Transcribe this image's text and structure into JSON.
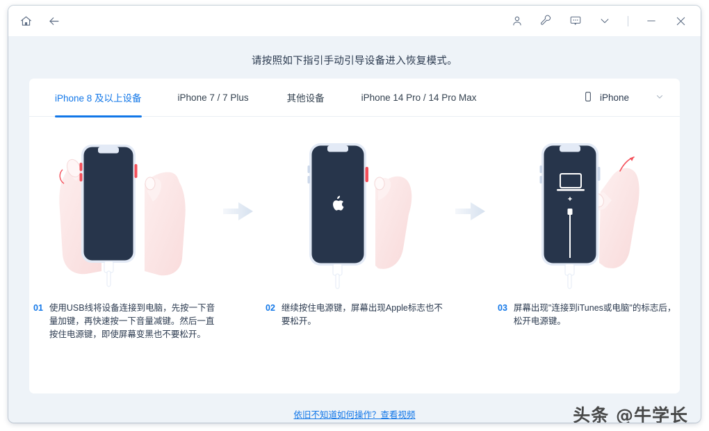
{
  "titlebar": {
    "left_buttons": [
      {
        "name": "home-icon",
        "label": "主页"
      },
      {
        "name": "back-arrow-icon",
        "label": "返回"
      }
    ],
    "right_buttons": [
      {
        "name": "user-account-icon",
        "label": "账户"
      },
      {
        "name": "wrench-tools-icon",
        "label": "工具"
      },
      {
        "name": "feedback-chat-icon",
        "label": "反馈"
      },
      {
        "name": "chevron-down-icon",
        "label": "更多"
      }
    ],
    "window_controls": [
      {
        "name": "minimize-button",
        "label": "—"
      },
      {
        "name": "close-button",
        "label": "✕"
      }
    ]
  },
  "heading": {
    "text": "请按照如下指引手动引导设备进入恢复模式。"
  },
  "tabs": [
    {
      "label": "iPhone 8 及以上设备",
      "active": true
    },
    {
      "label": "iPhone 7 / 7 Plus",
      "active": false
    },
    {
      "label": "其他设备",
      "active": false
    },
    {
      "label": "iPhone 14 Pro / 14 Pro Max",
      "active": false
    }
  ],
  "device_selector": {
    "icon": "phone-icon",
    "value": "iPhone",
    "chevron": "chevron-down-icon"
  },
  "steps": [
    {
      "number": "01",
      "text": "使用USB线将设备连接到电脑，先按一下音量加键，再快速按一下音量减键。然后一直按住电源键，即使屏幕变黑也不要松开。",
      "illustration": "hands-holding-iphone-pressing-volume-buttons"
    },
    {
      "number": "02",
      "text": "继续按住电源键，屏幕出现Apple标志也不要松开。",
      "illustration": "iphone-showing-apple-logo-hand-holding-power-button"
    },
    {
      "number": "03",
      "text": "屏幕出现\"连接到iTunes或电脑\"的标志后，松开电源键。",
      "illustration": "iphone-showing-connect-to-computer-hand-releasing"
    }
  ],
  "separators": [
    {
      "name": "arrow-right-icon"
    },
    {
      "name": "arrow-right-icon"
    }
  ],
  "footer": {
    "link_text": "依旧不知道如何操作？查看视频"
  },
  "watermark": {
    "text": "头条 @牛学长"
  },
  "colors": {
    "accent": "#1277e8",
    "page_background": "#eef3f8",
    "card_background": "#ffffff",
    "text_primary": "#2b3a4f",
    "phone_screen": "#27354b",
    "highlight_red": "#f4505a"
  }
}
